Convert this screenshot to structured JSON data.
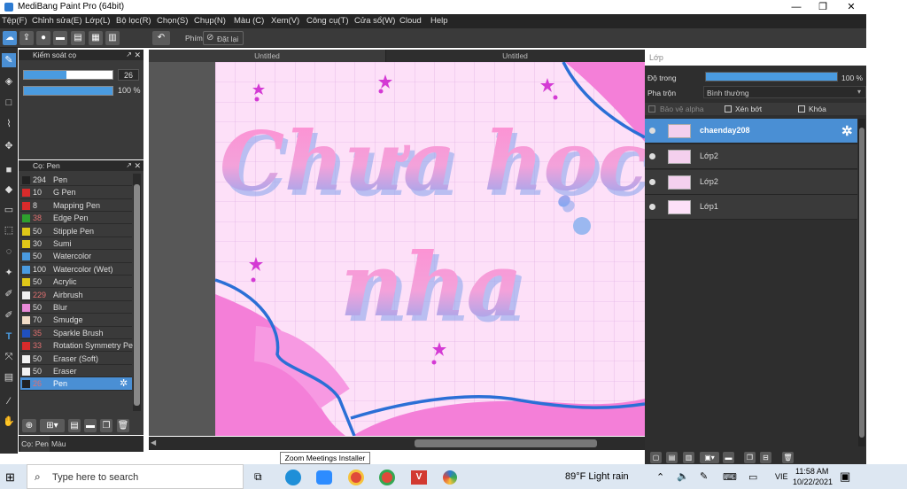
{
  "window": {
    "title": "MediBang Paint Pro (64bit)",
    "minimize": "—",
    "restore": "❐",
    "close": "✕"
  },
  "menu": [
    "Tệp(F)",
    "Chỉnh sửa(E)",
    "Lớp(L)",
    "Bộ lọc(R)",
    "Chọn(S)",
    "Chụp(N)",
    "Màu (C)",
    "Xem(V)",
    "Công cụ(T)",
    "Cửa sổ(W)",
    "Cloud",
    "Help"
  ],
  "toolbar": {
    "shortcut_label": "Phím",
    "reset_label": "Đặt lại"
  },
  "brush_control": {
    "title": "Kiểm soát cọ",
    "size_value": "26",
    "size_fraction": 0.48,
    "opacity_value": "100 %",
    "opacity_fraction": 1.0
  },
  "brush_panel": {
    "title": "Cọ: Pen",
    "items": [
      {
        "num": "294",
        "name": "Pen",
        "color": "#222222",
        "numcolor": "#dddddd"
      },
      {
        "num": "10",
        "name": "G Pen",
        "color": "#d92b2b",
        "numcolor": "#dddddd"
      },
      {
        "num": "8",
        "name": "Mapping Pen",
        "color": "#d92b2b",
        "numcolor": "#dddddd"
      },
      {
        "num": "38",
        "name": "Edge Pen",
        "color": "#2ea02e",
        "numcolor": "#e07070"
      },
      {
        "num": "50",
        "name": "Stipple Pen",
        "color": "#e0c818",
        "numcolor": "#dddddd"
      },
      {
        "num": "30",
        "name": "Sumi",
        "color": "#e0c818",
        "numcolor": "#dddddd"
      },
      {
        "num": "50",
        "name": "Watercolor",
        "color": "#4a9be0",
        "numcolor": "#dddddd"
      },
      {
        "num": "100",
        "name": "Watercolor (Wet)",
        "color": "#4a9be0",
        "numcolor": "#dddddd"
      },
      {
        "num": "50",
        "name": "Acrylic",
        "color": "#e0c818",
        "numcolor": "#dddddd"
      },
      {
        "num": "229",
        "name": "Airbrush",
        "color": "#f2f2f2",
        "numcolor": "#e07070"
      },
      {
        "num": "50",
        "name": "Blur",
        "color": "#e98ad8",
        "numcolor": "#dddddd"
      },
      {
        "num": "70",
        "name": "Smudge",
        "color": "#f2dcc8",
        "numcolor": "#dddddd"
      },
      {
        "num": "35",
        "name": "Sparkle Brush",
        "color": "#2050c0",
        "numcolor": "#e07070"
      },
      {
        "num": "33",
        "name": "Rotation Symmetry Pen",
        "color": "#d92b2b",
        "numcolor": "#e07070"
      },
      {
        "num": "50",
        "name": "Eraser (Soft)",
        "color": "#f2f2f2",
        "numcolor": "#dddddd"
      },
      {
        "num": "50",
        "name": "Eraser",
        "color": "#f2f2f2",
        "numcolor": "#dddddd"
      },
      {
        "num": "26",
        "name": "Pen",
        "color": "#222222",
        "numcolor": "#e07070"
      }
    ]
  },
  "left_tabs": {
    "brush": "Cọ: Pen",
    "color": "Màu"
  },
  "document_tabs": [
    "Untitled",
    "Untitled"
  ],
  "canvas": {
    "line1": "Chưa học",
    "line2": "nha"
  },
  "layer_panel": {
    "title": "Lớp",
    "opacity_label": "Độ trong",
    "opacity_value": "100 %",
    "opacity_fraction": 1.0,
    "blend_label": "Pha trộn",
    "blend_value": "Bình thường",
    "protect_alpha": "Bảo vệ alpha",
    "clipping": "Xén bớt",
    "lock": "Khóa",
    "layers": [
      "chaenday208",
      "Lớp2",
      "Lớp2",
      "Lớp1"
    ]
  },
  "tooltip": "Zoom Meetings Installer",
  "taskbar": {
    "search_placeholder": "Type here to search",
    "weather": "89°F  Light rain",
    "lang": "VIE",
    "time": "11:58 AM",
    "date": "10/22/2021"
  }
}
